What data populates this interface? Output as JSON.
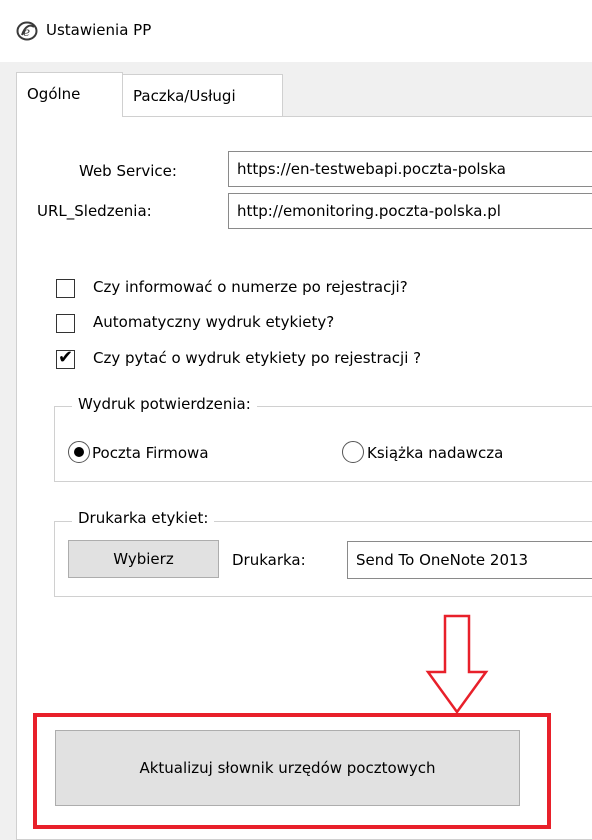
{
  "window": {
    "title": "Ustawienia PP",
    "icon": "app-logo-icon"
  },
  "tabs": [
    {
      "label": "Ogólne",
      "active": true
    },
    {
      "label": "Paczka/Usługi",
      "active": false
    }
  ],
  "fields": {
    "web_service_label": "Web Service:",
    "web_service_value": "https://en-testwebapi.poczta-polska",
    "url_label": "URL_Sledzenia:",
    "url_value": "http://emonitoring.poczta-polska.pl"
  },
  "checkboxes": [
    {
      "label": "Czy informować o numerze po rejestracji?",
      "checked": false
    },
    {
      "label": "Automatyczny wydruk etykiety?",
      "checked": false
    },
    {
      "label": "Czy pytać o wydruk etykiety po rejestracji ?",
      "checked": true
    }
  ],
  "confirmation_group": {
    "title": "Wydruk potwierdzenia:",
    "options": [
      {
        "label": "Poczta Firmowa",
        "selected": true
      },
      {
        "label": "Książka nadawcza",
        "selected": false
      }
    ]
  },
  "printer_group": {
    "title": "Drukarka etykiet:",
    "choose_button": "Wybierz",
    "printer_label": "Drukarka:",
    "printer_value": "Send To OneNote 2013"
  },
  "update_button": "Aktualizuj słownik urzędów pocztowych",
  "annotation": {
    "highlight_color": "#e8202a",
    "arrow": "down-arrow-icon"
  }
}
